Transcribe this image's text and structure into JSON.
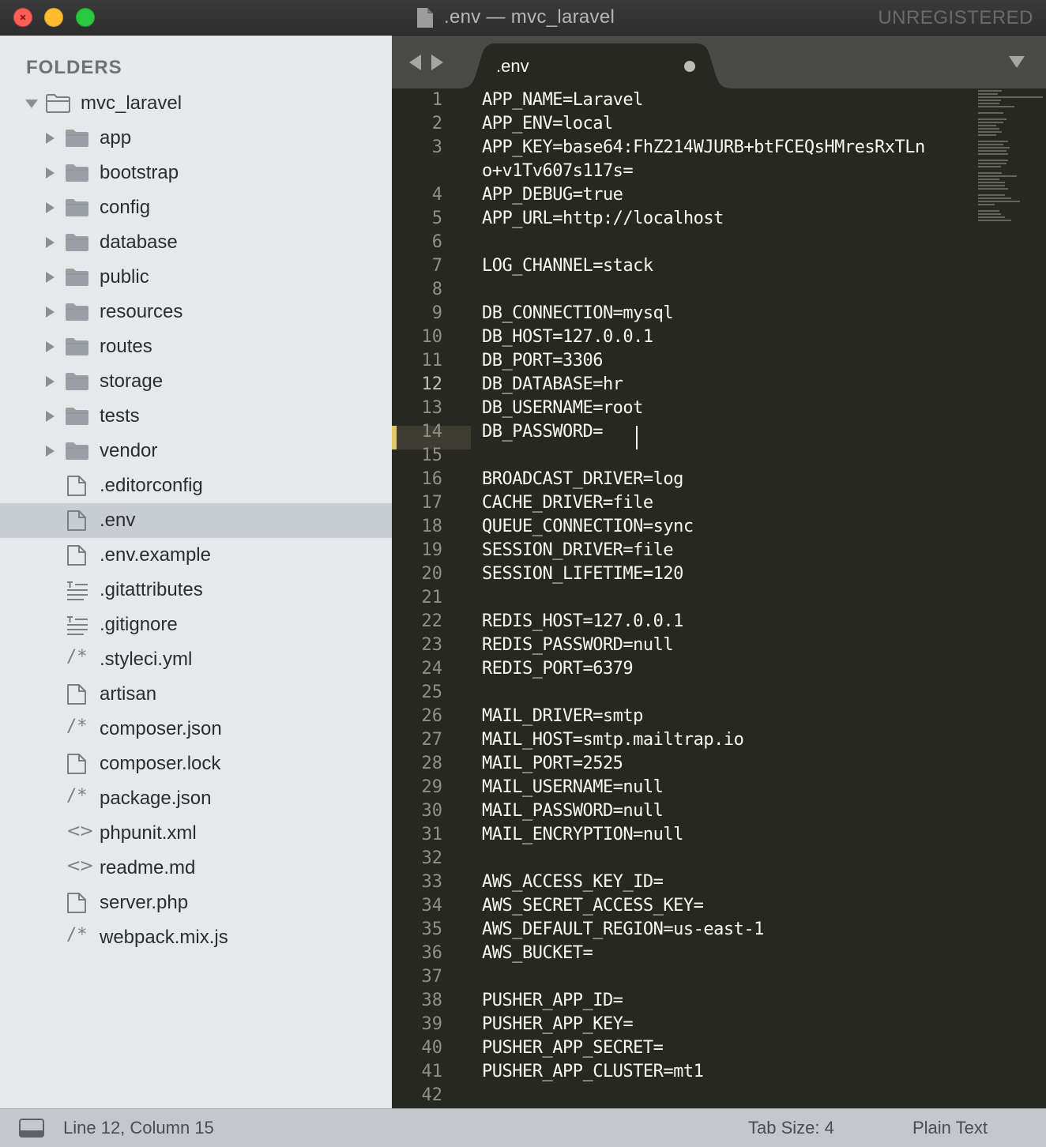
{
  "window": {
    "title": ".env — mvc_laravel",
    "registration": "UNREGISTERED"
  },
  "sidebar": {
    "header": "FOLDERS",
    "root": "mvc_laravel",
    "folders": [
      "app",
      "bootstrap",
      "config",
      "database",
      "public",
      "resources",
      "routes",
      "storage",
      "tests",
      "vendor"
    ],
    "files": [
      {
        "name": ".editorconfig",
        "icon": "file-icon"
      },
      {
        "name": ".env",
        "icon": "file-icon",
        "selected": true
      },
      {
        "name": ".env.example",
        "icon": "file-icon"
      },
      {
        "name": ".gitattributes",
        "icon": "text-lines-icon"
      },
      {
        "name": ".gitignore",
        "icon": "text-lines-icon"
      },
      {
        "name": ".styleci.yml",
        "icon": "comment-icon"
      },
      {
        "name": "artisan",
        "icon": "file-icon"
      },
      {
        "name": "composer.json",
        "icon": "comment-icon"
      },
      {
        "name": "composer.lock",
        "icon": "file-icon"
      },
      {
        "name": "package.json",
        "icon": "comment-icon"
      },
      {
        "name": "phpunit.xml",
        "icon": "code-icon"
      },
      {
        "name": "readme.md",
        "icon": "code-icon"
      },
      {
        "name": "server.php",
        "icon": "file-icon"
      },
      {
        "name": "webpack.mix.js",
        "icon": "comment-icon"
      }
    ]
  },
  "editor": {
    "tab_label": ".env",
    "current_line": 12,
    "lines": [
      "APP_NAME=Laravel",
      "APP_ENV=local",
      "APP_KEY=base64:FhZ214WJURB+btFCEQsHMresRxTLn\no+v1Tv607s117s=",
      "APP_DEBUG=true",
      "APP_URL=http://localhost",
      "",
      "LOG_CHANNEL=stack",
      "",
      "DB_CONNECTION=mysql",
      "DB_HOST=127.0.0.1",
      "DB_PORT=3306",
      "DB_DATABASE=hr",
      "DB_USERNAME=root",
      "DB_PASSWORD=",
      "",
      "BROADCAST_DRIVER=log",
      "CACHE_DRIVER=file",
      "QUEUE_CONNECTION=sync",
      "SESSION_DRIVER=file",
      "SESSION_LIFETIME=120",
      "",
      "REDIS_HOST=127.0.0.1",
      "REDIS_PASSWORD=null",
      "REDIS_PORT=6379",
      "",
      "MAIL_DRIVER=smtp",
      "MAIL_HOST=smtp.mailtrap.io",
      "MAIL_PORT=2525",
      "MAIL_USERNAME=null",
      "MAIL_PASSWORD=null",
      "MAIL_ENCRYPTION=null",
      "",
      "AWS_ACCESS_KEY_ID=",
      "AWS_SECRET_ACCESS_KEY=",
      "AWS_DEFAULT_REGION=us-east-1",
      "AWS_BUCKET=",
      "",
      "PUSHER_APP_ID=",
      "PUSHER_APP_KEY=",
      "PUSHER_APP_SECRET=",
      "PUSHER_APP_CLUSTER=mt1",
      ""
    ]
  },
  "statusbar": {
    "position": "Line 12, Column 15",
    "tab_size": "Tab Size: 4",
    "syntax": "Plain Text"
  },
  "colors": {
    "editor_bg": "#272822",
    "sidebar_bg": "#e6e8ea",
    "selected_row": "#c8ccd3",
    "modified_marker": "#e2c66b"
  }
}
